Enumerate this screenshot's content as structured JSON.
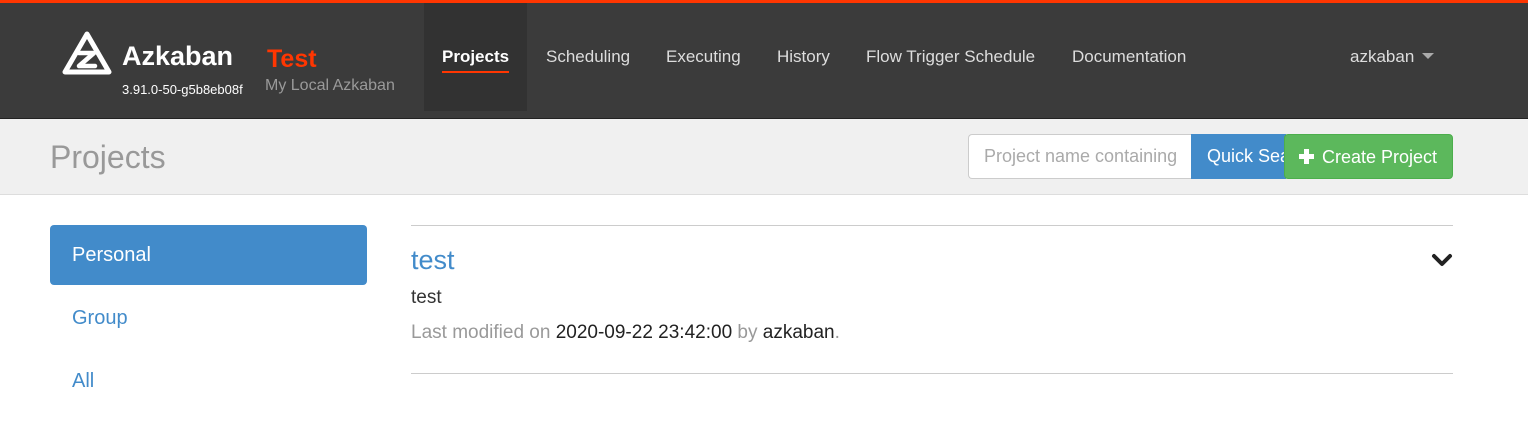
{
  "brand": {
    "name": "Azkaban",
    "env": "Test",
    "version": "3.91.0-50-g5b8eb08f",
    "subtitle": "My Local Azkaban"
  },
  "nav": {
    "items": [
      {
        "label": "Projects",
        "active": true
      },
      {
        "label": "Scheduling"
      },
      {
        "label": "Executing"
      },
      {
        "label": "History"
      },
      {
        "label": "Flow Trigger Schedule"
      },
      {
        "label": "Documentation"
      }
    ],
    "user": "azkaban"
  },
  "header": {
    "title": "Projects",
    "search_placeholder": "Project name containing",
    "search_button": "Quick Search",
    "create_button": "Create Project"
  },
  "sidebar": {
    "items": [
      {
        "label": "Personal",
        "active": true
      },
      {
        "label": "Group"
      },
      {
        "label": "All"
      }
    ]
  },
  "projects": [
    {
      "name": "test",
      "description": "test",
      "modified_prefix": "Last modified on",
      "modified_date": "2020-09-22 23:42:00",
      "by_label": "by",
      "modified_by": "azkaban",
      "end": "."
    }
  ],
  "colors": {
    "accent": "#ff3601",
    "primary": "#428bca",
    "success": "#5cb85c",
    "navbar": "#3b3b3b"
  },
  "icons": [
    "azkaban-logo-icon",
    "plus-icon",
    "chevron-down-icon",
    "caret-down-icon"
  ]
}
